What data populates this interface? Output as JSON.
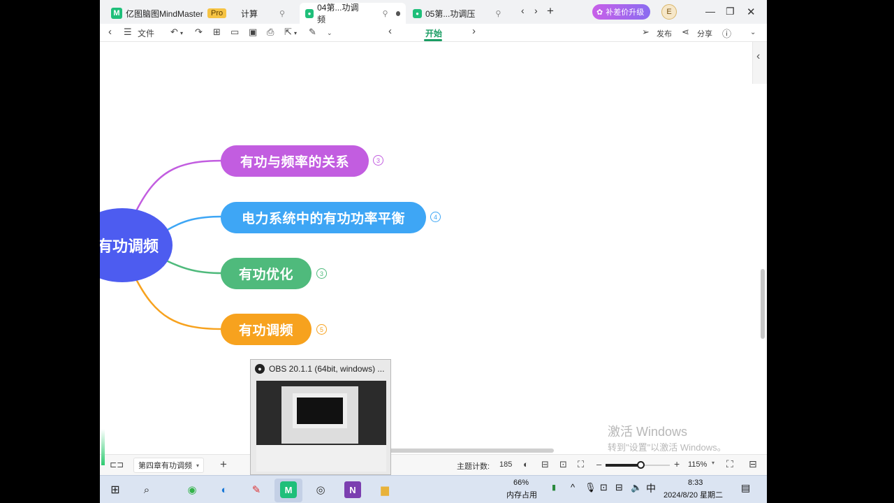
{
  "titlebar": {
    "app_name": "亿图脑图MindMaster",
    "pro_label": "Pro",
    "tab_calc": "计算",
    "tab_doc1": "04第...功调频",
    "tab_doc2": "05第...功调压",
    "upgrade_label": "补差价升级",
    "avatar_letter": "E"
  },
  "toolbar": {
    "file_label": "文件",
    "start_tab": "开始",
    "publish_label": "发布",
    "share_label": "分享"
  },
  "mindmap": {
    "root": "有功调频",
    "branches": [
      {
        "label": "有功与频率的关系",
        "count": "3",
        "color": "#c25de0"
      },
      {
        "label": "电力系统中的有功功率平衡",
        "count": "4",
        "color": "#3ea6f5"
      },
      {
        "label": "有功优化",
        "count": "3",
        "color": "#4fba7c"
      },
      {
        "label": "有功调频",
        "count": "5",
        "color": "#f7a21e"
      }
    ]
  },
  "watermark": {
    "line1": "激活 Windows",
    "line2": "转到\"设置\"以激活 Windows。"
  },
  "statusbar": {
    "sheet_name": "第四章有功调频",
    "topic_count_label": "主题计数:",
    "topic_count": "185",
    "zoom": "115%",
    "zoom_level": 0.55
  },
  "obs_preview": {
    "title": "OBS 20.1.1 (64bit, windows) ..."
  },
  "taskbar": {
    "memory_percent": "66%",
    "memory_label": "内存占用",
    "ime": "中",
    "time": "8:33",
    "date": "2024/8/20 星期二"
  }
}
